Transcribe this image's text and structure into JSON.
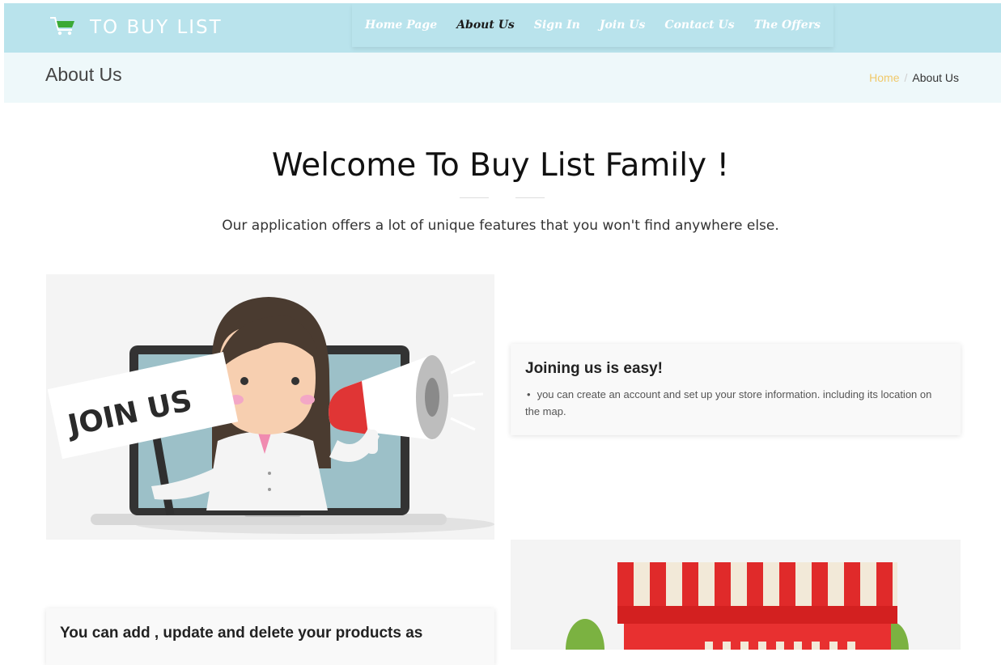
{
  "brand": {
    "name": "TO BUY LIST",
    "icon": "shopping-cart-icon",
    "accent": "#b9e3ec"
  },
  "nav": {
    "items": [
      {
        "label": "Home Page",
        "active": false
      },
      {
        "label": "About Us",
        "active": true
      },
      {
        "label": "Sign In",
        "active": false
      },
      {
        "label": "Join Us",
        "active": false
      },
      {
        "label": "Contact Us",
        "active": false
      },
      {
        "label": "The Offers",
        "active": false
      }
    ]
  },
  "page_header": {
    "title": "About Us",
    "breadcrumb": {
      "home": "Home",
      "separator": "/",
      "current": "About Us"
    }
  },
  "hero": {
    "title": "Welcome To Buy List Family !",
    "subtitle": "Our application offers a lot of unique features that you won't find anywhere else."
  },
  "features": [
    {
      "image_caption": "JOIN US",
      "title": "Joining us is easy!",
      "text": "you can create an account and set up your store information. including its location on the map."
    },
    {
      "title": "You can add , update and delete your products as"
    }
  ]
}
